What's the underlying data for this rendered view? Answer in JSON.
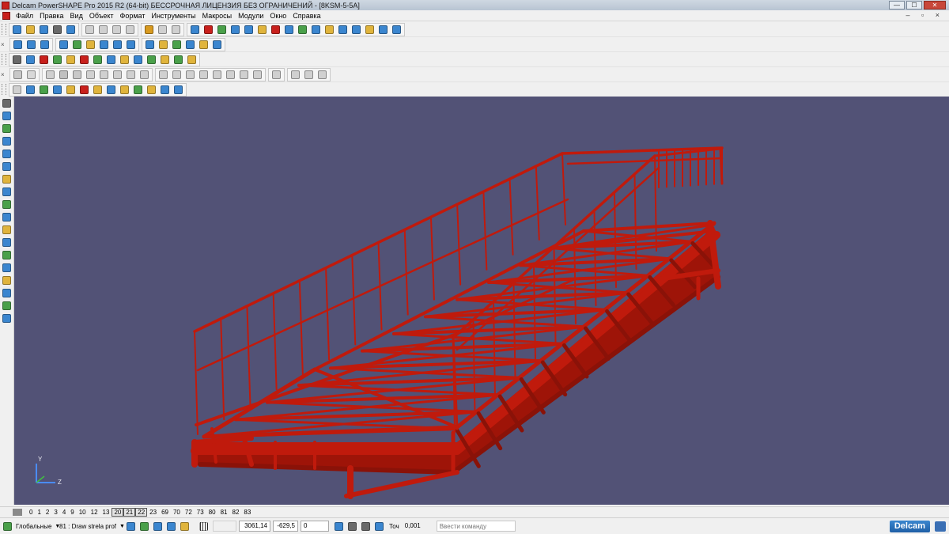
{
  "window": {
    "title": "Delcam PowerSHAPE Pro 2015 R2 (64-bit) БЕССРОЧНАЯ ЛИЦЕНЗИЯ БЕЗ ОГРАНИЧЕНИЙ - [8KSM-5-5A]",
    "minimize_glyph": "—",
    "maximize_glyph": "☐",
    "close_glyph": "✕"
  },
  "menu": {
    "items": [
      "Файл",
      "Правка",
      "Вид",
      "Объект",
      "Формат",
      "Инструменты",
      "Макросы",
      "Модули",
      "Окно",
      "Справка"
    ],
    "window_controls": "– ▫ ×"
  },
  "toolbars": {
    "row1": [
      [
        "#3b86cf",
        "#e0b43c",
        "#3b86cf",
        "#6a6a6a",
        "#3b86cf"
      ],
      [
        "#d0d0d0",
        "#d0d0d0",
        "#d0d0d0",
        "#d0d0d0"
      ],
      [
        "#d89a20",
        "#d0d0d0",
        "#d0d0d0"
      ],
      [
        "#3b86cf",
        "#c8201c",
        "#4aa04a",
        "#3b86cf",
        "#3b86cf",
        "#e0b43c",
        "#c8201c",
        "#3b86cf",
        "#4aa04a",
        "#3b86cf",
        "#e0b43c",
        "#3b86cf",
        "#3b86cf",
        "#e0b43c",
        "#3b86cf",
        "#3b86cf"
      ]
    ],
    "row2": [
      [
        "#3b86cf",
        "#3b86cf",
        "#3b86cf"
      ],
      [
        "#3b86cf",
        "#4aa04a",
        "#e0b43c",
        "#3b86cf",
        "#3b86cf",
        "#3b86cf"
      ],
      [
        "#3b86cf",
        "#e0b43c",
        "#4aa04a",
        "#3b86cf",
        "#e0b43c",
        "#3b86cf"
      ]
    ],
    "row3": [
      [
        "#6a6a6a",
        "#3b86cf",
        "#c8201c",
        "#4aa04a",
        "#e0b43c",
        "#c8201c",
        "#4aa04a",
        "#3b86cf",
        "#e0b43c",
        "#3b86cf",
        "#4aa04a",
        "#e0b43c",
        "#4aa04a",
        "#e0b43c"
      ]
    ],
    "row4": [
      [
        "#c8c8c8",
        "#d8d8d8"
      ],
      [
        "#d0d0d0",
        "#c0c0c0",
        "#c8c8c8",
        "#d0d0d0",
        "#d0d0d0",
        "#d0d0d0",
        "#d0d0d0",
        "#d0d0d0"
      ],
      [
        "#d0d0d0",
        "#d0d0d0",
        "#d0d0d0",
        "#d0d0d0",
        "#d0d0d0",
        "#d0d0d0",
        "#d0d0d0",
        "#d0d0d0"
      ],
      [
        "#d0d0d0"
      ],
      [
        "#d0d0d0",
        "#d0d0d0",
        "#d0d0d0"
      ]
    ],
    "row5": [
      [
        "#d0d0d0",
        "#3b86cf",
        "#4aa04a",
        "#3b86cf",
        "#e0b43c",
        "#c8201c",
        "#e0b43c",
        "#3b86cf",
        "#e0b43c",
        "#4aa04a",
        "#e0b43c",
        "#3b86cf",
        "#3b86cf"
      ]
    ],
    "left": [
      "#6a6a6a",
      "#3b86cf",
      "#4aa04a",
      "#3b86cf",
      "#3b86cf",
      "#3b86cf",
      "#e0b43c",
      "#3b86cf",
      "#4aa04a",
      "#3b86cf",
      "#e0b43c",
      "#3b86cf",
      "#4aa04a",
      "#3b86cf",
      "#e0b43c",
      "#3b86cf",
      "#4aa04a",
      "#3b86cf"
    ]
  },
  "viewport": {
    "background": "#525276",
    "model_color": "#c01a0c",
    "axis_y_label": "Y",
    "axis_z_label": "Z"
  },
  "levels": [
    "0",
    "1",
    "2",
    "3",
    "4",
    "9",
    "10",
    "12",
    "13",
    "20",
    "21",
    "22",
    "23",
    "69",
    "70",
    "72",
    "73",
    "80",
    "81",
    "82",
    "83"
  ],
  "levels_selected": [
    "20",
    "21",
    "22"
  ],
  "status": {
    "workplane": "Глобальные",
    "workplane_arrow": "▼",
    "macro": "81 : Draw strela prof",
    "macro_arrow": "▼",
    "x": "3061,14",
    "y": "-629,5",
    "z": "0",
    "tolerance_label": "Точ",
    "tolerance": "0,001",
    "command_placeholder": "Ввести команду",
    "brand": "Delcam"
  }
}
